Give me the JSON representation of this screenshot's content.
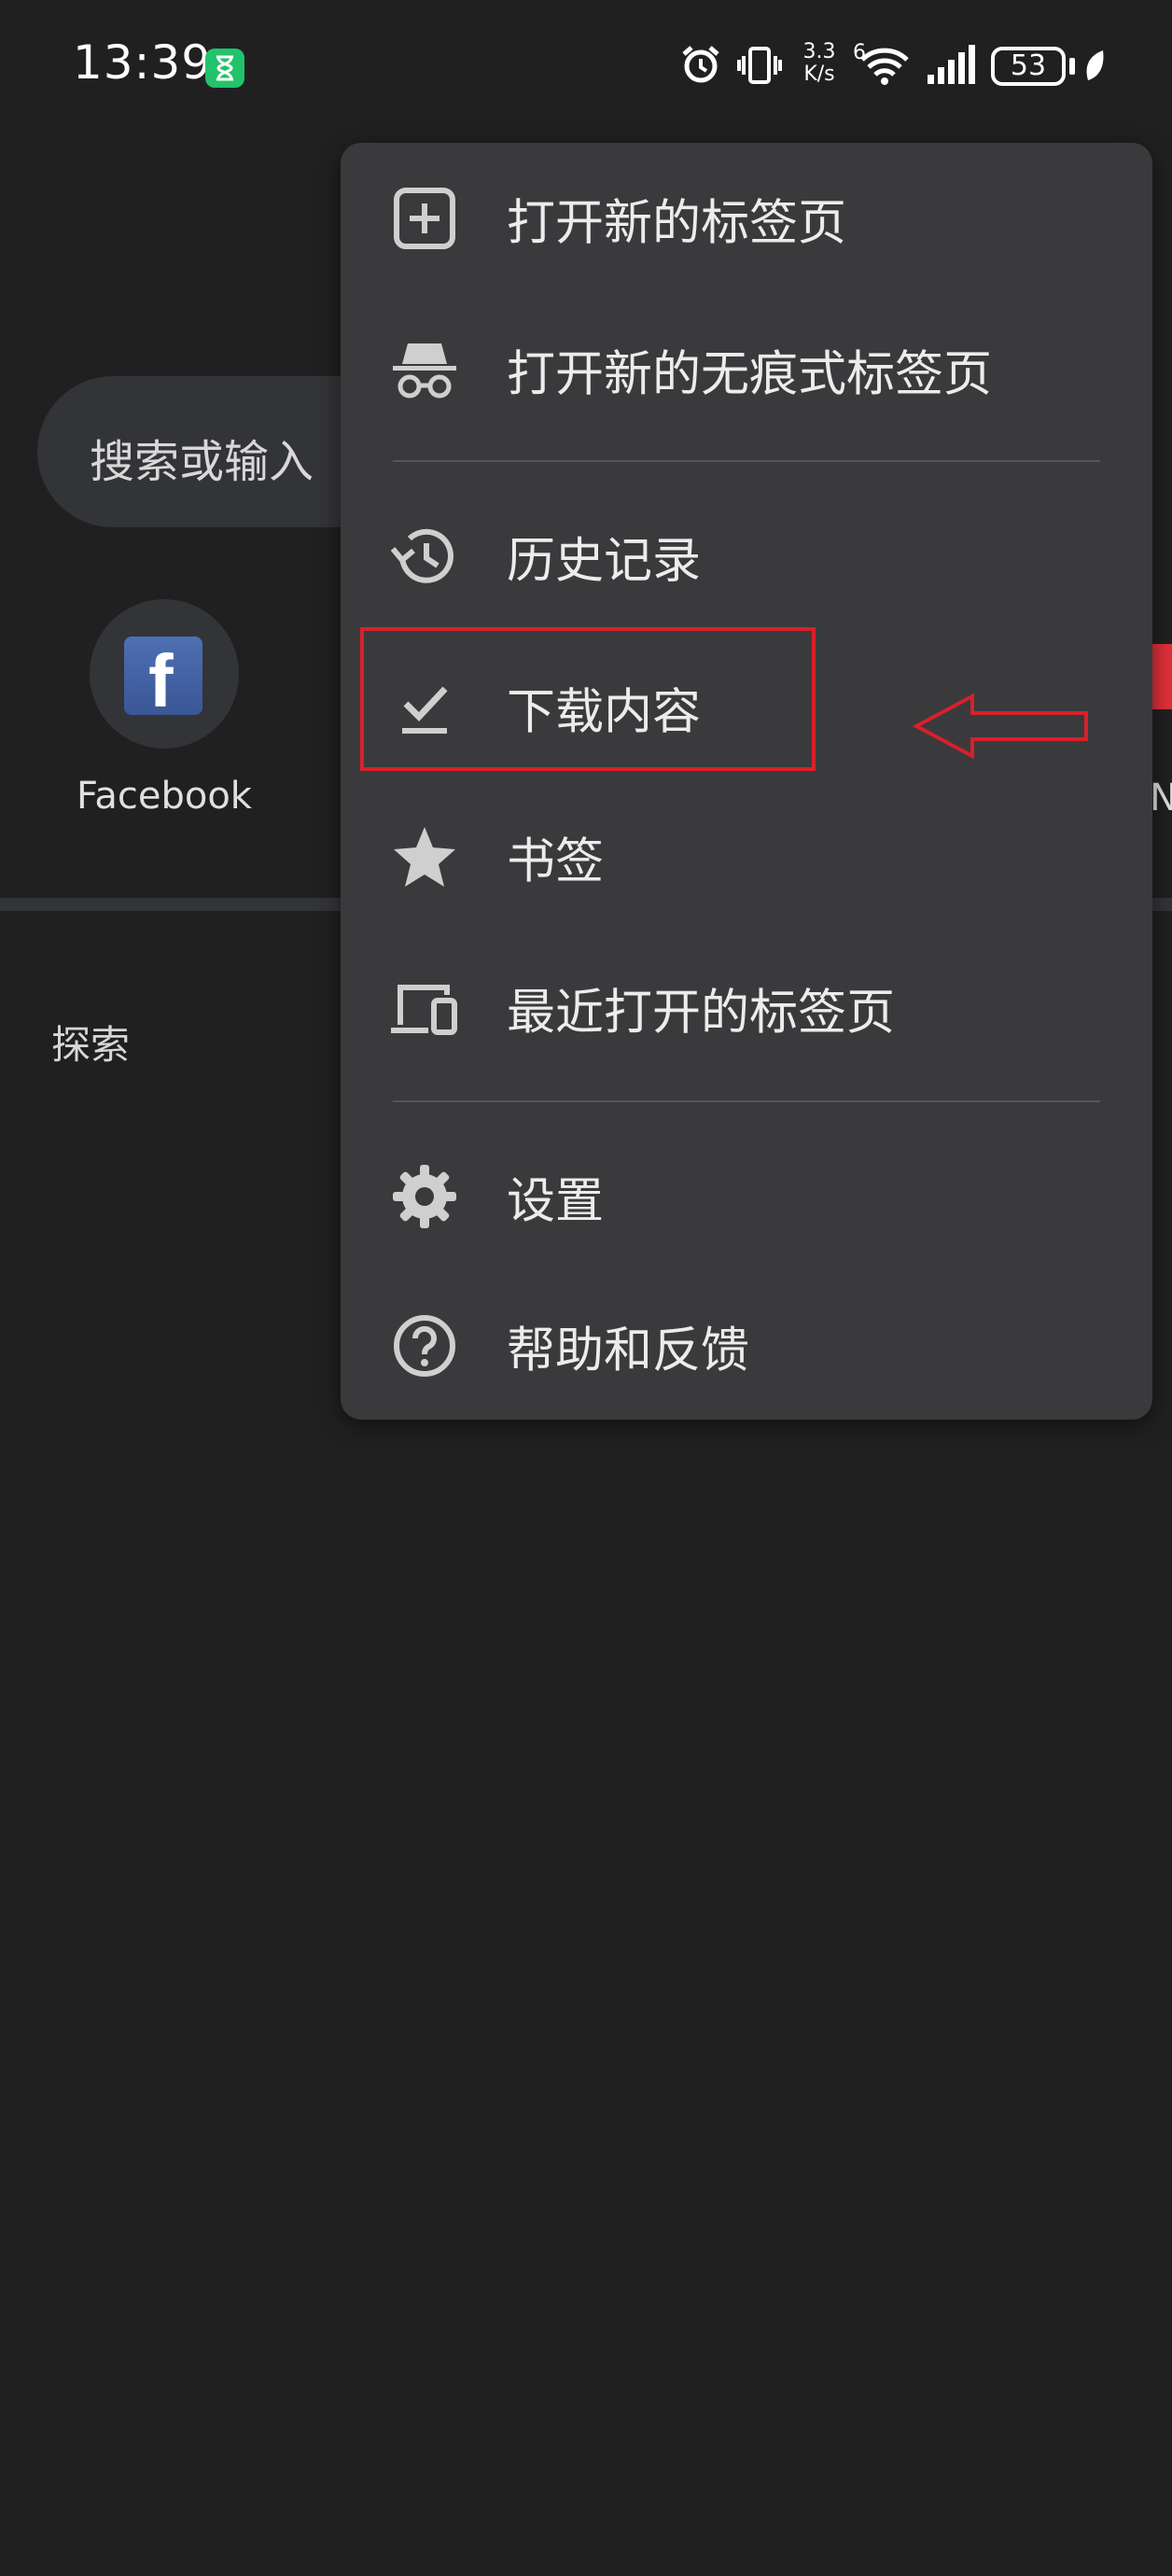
{
  "status_bar": {
    "time": "13:39",
    "net_speed_value": "3.3",
    "net_speed_unit": "K/s",
    "wifi_label": "6",
    "battery": "53"
  },
  "search": {
    "placeholder": "搜索或输入"
  },
  "shortcuts": [
    {
      "label": "Facebook",
      "icon": "facebook-icon"
    },
    {
      "label": "N",
      "icon": "red-site-icon"
    }
  ],
  "explore_label": "探索",
  "menu": {
    "items": [
      {
        "label": "打开新的标签页",
        "icon": "new-tab-icon"
      },
      {
        "label": "打开新的无痕式标签页",
        "icon": "incognito-icon"
      },
      {
        "label": "历史记录",
        "icon": "history-icon"
      },
      {
        "label": "下载内容",
        "icon": "download-check-icon"
      },
      {
        "label": "书签",
        "icon": "star-icon"
      },
      {
        "label": "最近打开的标签页",
        "icon": "devices-icon"
      },
      {
        "label": "设置",
        "icon": "gear-icon"
      },
      {
        "label": "帮助和反馈",
        "icon": "help-icon"
      }
    ]
  },
  "annotation": {
    "highlight_color": "#d8202a",
    "highlighted_item": "下载内容"
  }
}
